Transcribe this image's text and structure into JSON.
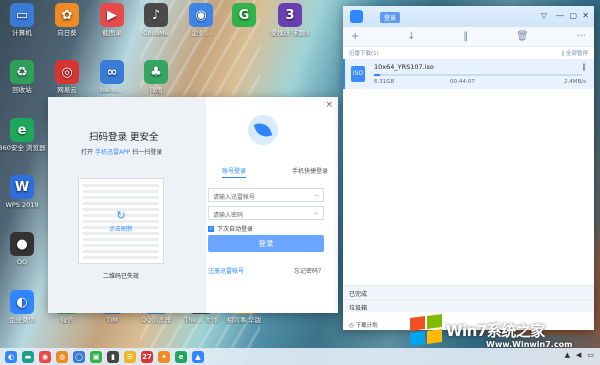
{
  "desktop": {
    "icons": [
      {
        "label": "计算机",
        "color": "#3a7bd5",
        "glyph": "▭"
      },
      {
        "label": "向日葵",
        "color": "#f08a24",
        "glyph": "✿"
      },
      {
        "label": "截图录",
        "color": "#e84a4a",
        "glyph": "▶"
      },
      {
        "label": "CocoMu",
        "color": "#4a4a4a",
        "glyph": "♪"
      },
      {
        "label": "企业...",
        "color": "#3f85e8",
        "glyph": "◉"
      },
      {
        "label": "",
        "color": "#2fb34a",
        "glyph": "G"
      },
      {
        "label": "愛撲班 宋趣3",
        "color": "#6a3fb0",
        "glyph": "3"
      },
      {
        "label": "回收站",
        "color": "#2f9f5a",
        "glyph": "♻"
      },
      {
        "label": "网易云",
        "color": "#d93434",
        "glyph": "◎"
      },
      {
        "label": "baidu...",
        "color": "#3a7bd5",
        "glyph": "∞"
      },
      {
        "label": "微雨",
        "color": "#33a663",
        "glyph": "♣"
      },
      {
        "label": "360安全 浏览器",
        "color": "#1fa85b",
        "glyph": "e"
      },
      {
        "label": "WPS 2019",
        "color": "#2f6fdb",
        "glyph": "W"
      },
      {
        "label": "QQ",
        "color": "#333333",
        "glyph": "●"
      },
      {
        "label": "企业微信",
        "color": "#2f86ff",
        "glyph": "◐"
      },
      {
        "label": "微信",
        "color": "#2fb34a",
        "glyph": "●"
      },
      {
        "label": "TIM",
        "color": "#3a7bd5",
        "glyph": "T"
      },
      {
        "label": "QQ浏览器",
        "color": "#2f86ff",
        "glyph": "Q"
      },
      {
        "label": "The... 大师",
        "color": "#4a4a4a",
        "glyph": "▤"
      },
      {
        "label": "相同事 华版",
        "color": "#f0b424",
        "glyph": "◇"
      }
    ]
  },
  "login": {
    "title": "扫码登录 更安全",
    "subtitle_pre": "打开",
    "subtitle_app": "手机迅雷APP",
    "subtitle_post": "扫一扫登录",
    "qr_refresh_label": "点击刷新",
    "qr_caption": "二维码已失效",
    "tab_account": "账号登录",
    "tab_phone": "手机快捷登录",
    "account_placeholder": "请输入迅雷帐号",
    "password_placeholder": "请输入密码",
    "auto_login_label": "下次自动登录",
    "login_button": "登录",
    "register_link": "注册迅雷帐号",
    "forgot_link": "忘记密码？",
    "close_glyph": "×"
  },
  "downloader": {
    "login_badge": "登录",
    "status_left": "迅雷下载(1)",
    "status_right": "‖ 全部暂停",
    "tools": {
      "add": "+",
      "down": "↓",
      "pause": "‖",
      "delete": "🗑",
      "more": "···"
    },
    "item": {
      "filename": "10x64_YRS107.iso",
      "size": "6.31GB",
      "time": "00:44:07",
      "speed": "2.4MB/s",
      "progress": 0.03
    },
    "completed_label": "已完成",
    "trash_label": "垃圾箱",
    "plan_label": "下载计划"
  },
  "watermark": {
    "text": "Win7系统之家",
    "url": "Www.Winwin7.com"
  },
  "taskbar": {
    "icons": [
      {
        "glyph": "◐",
        "color": "#2f86ff"
      },
      {
        "glyph": "▬",
        "color": "#1e9e8a"
      },
      {
        "glyph": "◉",
        "color": "#e84a4a"
      },
      {
        "glyph": "◍",
        "color": "#f08a24"
      },
      {
        "glyph": "◯",
        "color": "#3a7bd5"
      },
      {
        "glyph": "▣",
        "color": "#2fb34a"
      },
      {
        "glyph": "▮",
        "color": "#444444"
      },
      {
        "glyph": "☰",
        "color": "#f0b424"
      },
      {
        "glyph": "27",
        "color": "#d93434"
      },
      {
        "glyph": "✦",
        "color": "#f08a24"
      },
      {
        "glyph": "e",
        "color": "#1fa85b"
      },
      {
        "glyph": "▲",
        "color": "#2f86ff"
      }
    ]
  }
}
